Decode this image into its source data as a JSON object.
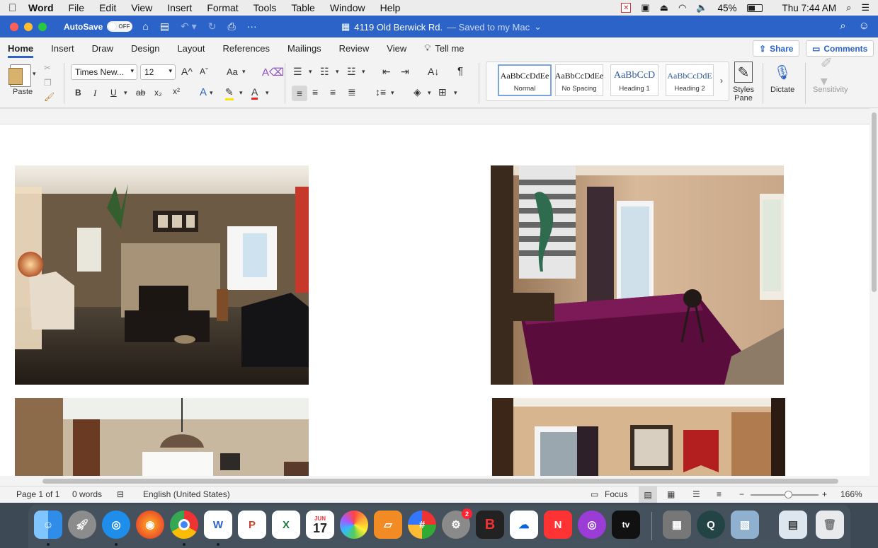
{
  "menubar": {
    "app_name": "Word",
    "items": [
      "File",
      "Edit",
      "View",
      "Insert",
      "Format",
      "Tools",
      "Table",
      "Window",
      "Help"
    ],
    "battery": "45%",
    "clock": "Thu 7:44 AM"
  },
  "titlebar": {
    "autosave_label": "AutoSave",
    "autosave_state": "OFF",
    "document_name": "4119 Old Berwick Rd.",
    "saved_status": "— Saved to my Mac"
  },
  "ribbon_tabs": {
    "tabs": [
      "Home",
      "Insert",
      "Draw",
      "Design",
      "Layout",
      "References",
      "Mailings",
      "Review",
      "View"
    ],
    "tell_me": "Tell me",
    "share": "Share",
    "comments": "Comments"
  },
  "ribbon": {
    "paste_label": "Paste",
    "font_name": "Times New...",
    "font_size": "12",
    "styles": [
      {
        "preview": "AaBbCcDdEe",
        "label": "Normal"
      },
      {
        "preview": "AaBbCcDdEe",
        "label": "No Spacing"
      },
      {
        "preview": "AaBbCcD",
        "label": "Heading 1"
      },
      {
        "preview": "AaBbCcDdE",
        "label": "Heading 2"
      }
    ],
    "styles_pane_label": "Styles Pane",
    "dictate_label": "Dictate",
    "sensitivity_label": "Sensitivity",
    "bold": "B",
    "italic": "I",
    "underline": "U",
    "strike": "ab",
    "case": "Aa"
  },
  "statusbar": {
    "page": "Page 1 of 1",
    "words": "0 words",
    "language": "English (United States)",
    "focus": "Focus",
    "zoom": "166%",
    "zoom_level_fraction": 0.55
  },
  "dock": {
    "calendar_month": "JUN",
    "calendar_day": "17",
    "prefs_badge": "2"
  }
}
